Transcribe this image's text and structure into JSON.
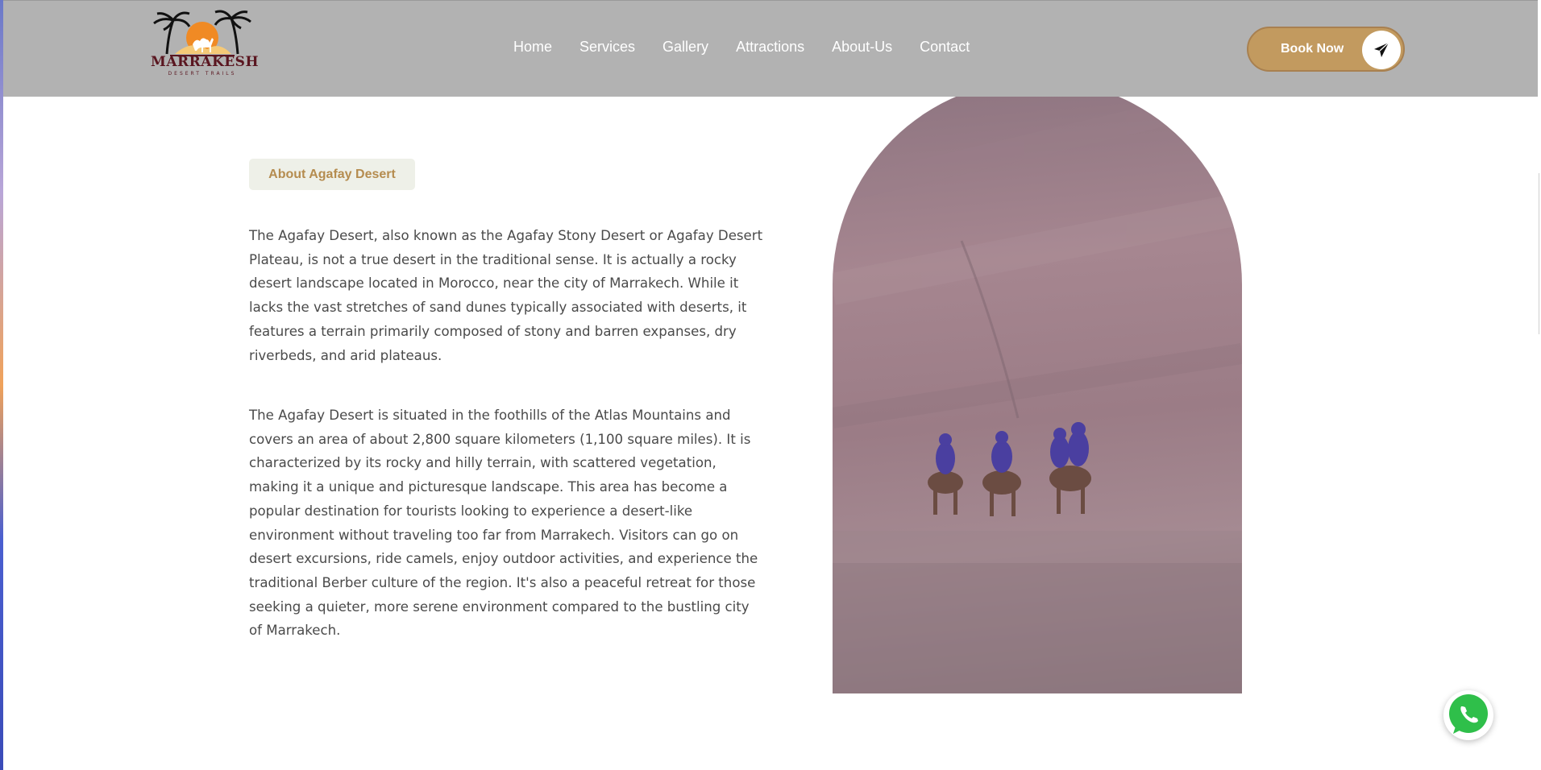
{
  "brand": {
    "name": "MARRAKESH",
    "tagline": "DESERT TRAILS"
  },
  "nav": {
    "items": [
      {
        "label": "Home"
      },
      {
        "label": "Services"
      },
      {
        "label": "Gallery"
      },
      {
        "label": "Attractions"
      },
      {
        "label": "About-Us"
      },
      {
        "label": "Contact"
      }
    ]
  },
  "header": {
    "book_label": "Book Now",
    "book_icon": "paper-plane-icon"
  },
  "content": {
    "badge": "About Agafay Desert",
    "paragraph_1": "The Agafay Desert, also known as the Agafay Stony Desert or Agafay Desert Plateau, is not a true desert in the traditional sense. It is actually a rocky desert landscape located in Morocco, near the city of Marrakech. While it lacks the vast stretches of sand dunes typically associated with deserts, it features a terrain primarily composed of stony and barren expanses, dry riverbeds, and arid plateaus.",
    "paragraph_2": "The Agafay Desert is situated in the foothills of the Atlas Mountains and covers an area of about 2,800 square kilometers (1,100 square miles). It is characterized by its rocky and hilly terrain, with scattered vegetation, making it a unique and picturesque landscape. This area has become a popular destination for tourists looking to experience a desert-like environment without traveling too far from Marrakech. Visitors can go on desert excursions, ride camels, enjoy outdoor activities, and experience the traditional Berber culture of the region. It's also a peaceful retreat for those seeking a quieter, more serene environment compared to the bustling city of Marrakech."
  },
  "colors": {
    "header_bg": "#b2b2b2",
    "accent": "#c29a5f",
    "badge_bg": "#eef0e8",
    "brand_dark": "#5a1620",
    "whatsapp_green": "#2fbf4a"
  },
  "icons": {
    "whatsapp": "whatsapp-icon",
    "logo": "palm-camel-sun-logo"
  }
}
